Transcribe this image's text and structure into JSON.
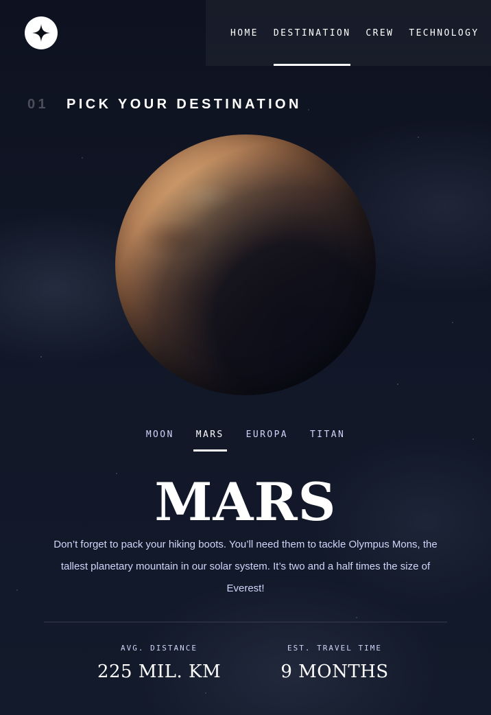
{
  "header": {
    "logo_icon": "four-point-star-icon",
    "nav": [
      {
        "label": "HOME",
        "active": false
      },
      {
        "label": "DESTINATION",
        "active": true
      },
      {
        "label": "CREW",
        "active": false
      },
      {
        "label": "TECHNOLOGY",
        "active": false
      }
    ]
  },
  "section": {
    "number": "01",
    "title": "PICK YOUR DESTINATION"
  },
  "planet": {
    "icon": "planet-mars-image"
  },
  "tabs": [
    {
      "label": "MOON",
      "active": false
    },
    {
      "label": "MARS",
      "active": true
    },
    {
      "label": "EUROPA",
      "active": false
    },
    {
      "label": "TITAN",
      "active": false
    }
  ],
  "destination": {
    "name": "MARS",
    "description": "Don’t forget to pack your hiking boots. You’ll need them to tackle Olympus Mons, the tallest planetary mountain in our solar system. It’s two and a half times the size of Everest!",
    "stats": [
      {
        "label": "AVG. DISTANCE",
        "value": "225 MIL. KM"
      },
      {
        "label": "EST. TRAVEL TIME",
        "value": "9 MONTHS"
      }
    ]
  },
  "colors": {
    "background": "#0b0d17",
    "accent_text": "#d0d6f9",
    "white": "#ffffff",
    "divider": "#383b4b"
  }
}
